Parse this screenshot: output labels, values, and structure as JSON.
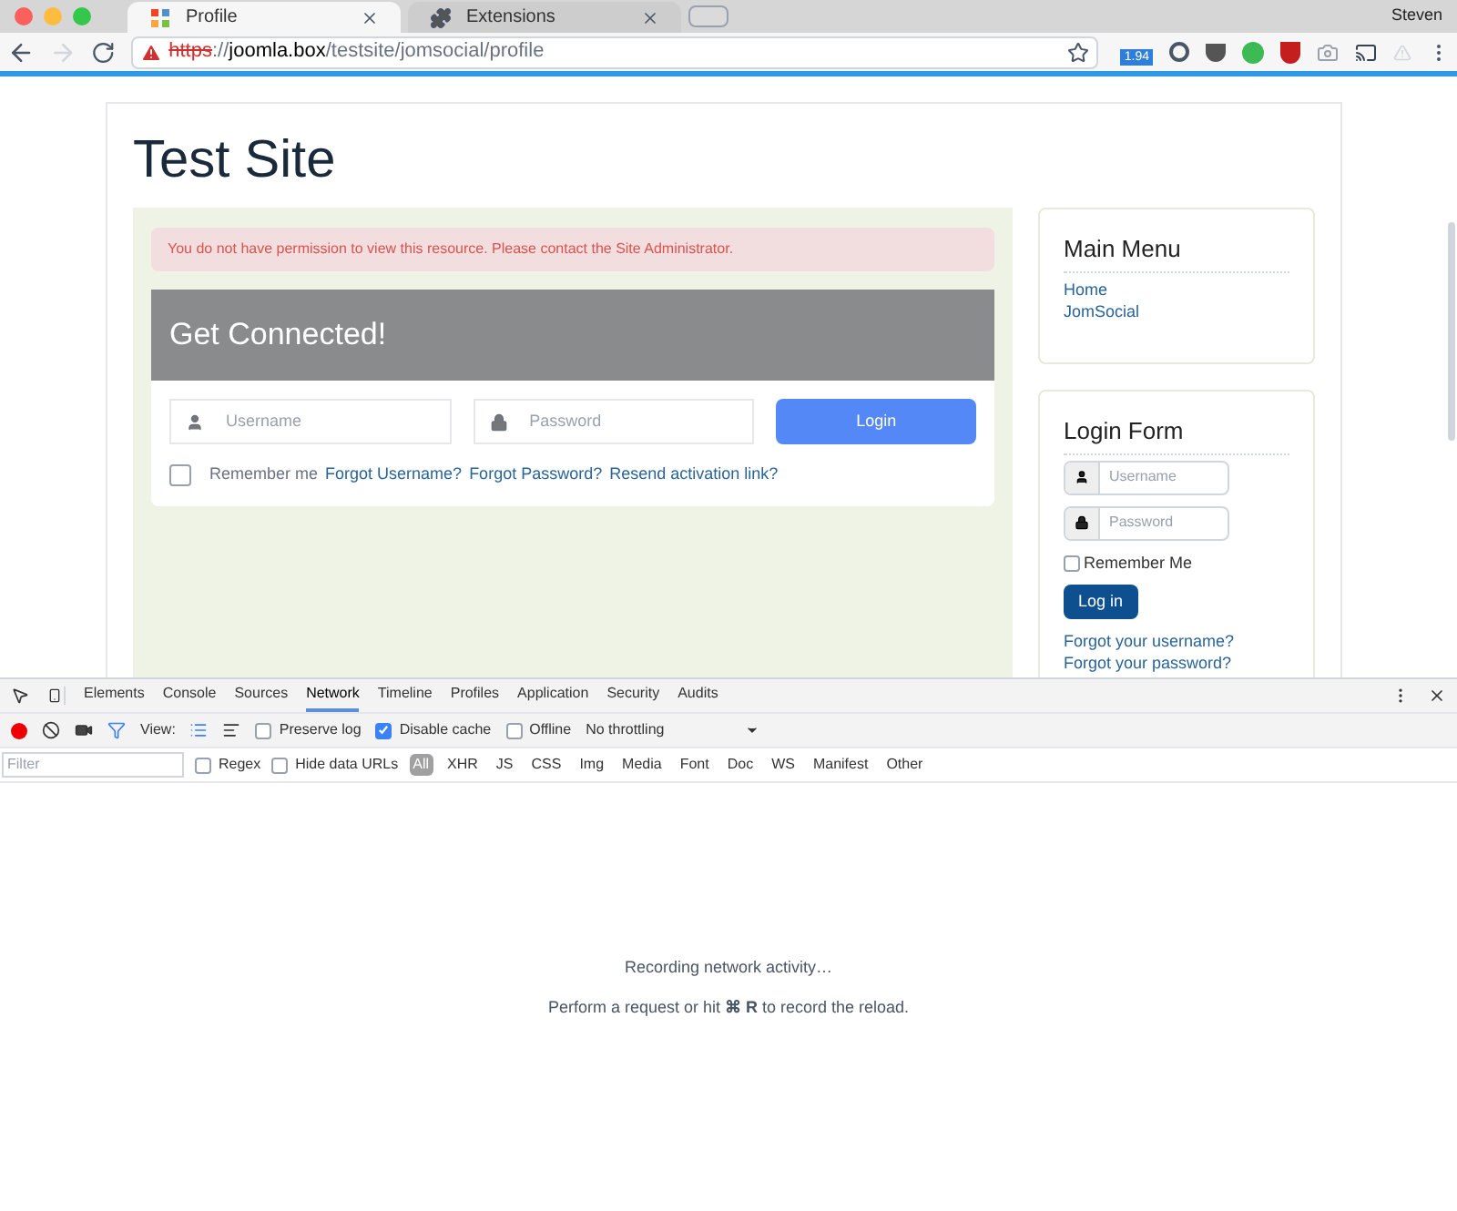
{
  "browser": {
    "tabs": [
      {
        "title": "Profile",
        "selected": true,
        "kind": "joomla"
      },
      {
        "title": "Extensions",
        "selected": false,
        "kind": "puzzle"
      }
    ],
    "user": "Steven",
    "url": {
      "scheme": "https",
      "separator": "://",
      "host": "joomla.box",
      "path": "/testsite/jomsocial/profile"
    },
    "extension_badge": "1.94"
  },
  "page": {
    "site_title": "Test Site",
    "alert": "You do not have permission to view this resource. Please contact the Site Administrator.",
    "card": {
      "heading": "Get Connected!",
      "username_placeholder": "Username",
      "password_placeholder": "Password",
      "login_button": "Login",
      "remember_label": "Remember me",
      "remember_checked": false,
      "links": [
        "Forgot Username?",
        "Forgot Password?",
        "Resend activation link?"
      ]
    },
    "main_menu": {
      "title": "Main Menu",
      "items": [
        "Home",
        "JomSocial"
      ]
    },
    "login_form": {
      "title": "Login Form",
      "username_placeholder": "Username",
      "password_placeholder": "Password",
      "remember_label": "Remember Me",
      "remember_checked": false,
      "button": "Log in",
      "links": [
        "Forgot your username?",
        "Forgot your password?"
      ]
    }
  },
  "devtools": {
    "tabs": [
      {
        "label": "Elements",
        "selected": false
      },
      {
        "label": "Console",
        "selected": false
      },
      {
        "label": "Sources",
        "selected": false
      },
      {
        "label": "Network",
        "selected": true
      },
      {
        "label": "Timeline",
        "selected": false
      },
      {
        "label": "Profiles",
        "selected": false
      },
      {
        "label": "Application",
        "selected": false
      },
      {
        "label": "Security",
        "selected": false
      },
      {
        "label": "Audits",
        "selected": false
      }
    ],
    "recording": true,
    "view_label": "View:",
    "options": [
      {
        "label": "Preserve log",
        "checked": false
      },
      {
        "label": "Disable cache",
        "checked": true
      },
      {
        "label": "Offline",
        "checked": false
      }
    ],
    "throttling": "No throttling",
    "filter_placeholder": "Filter",
    "filter_options": [
      {
        "label": "Regex",
        "checked": false
      },
      {
        "label": "Hide data URLs",
        "checked": false
      }
    ],
    "types": [
      {
        "label": "All",
        "selected": true
      },
      {
        "label": "XHR",
        "selected": false
      },
      {
        "label": "JS",
        "selected": false
      },
      {
        "label": "CSS",
        "selected": false
      },
      {
        "label": "Img",
        "selected": false
      },
      {
        "label": "Media",
        "selected": false
      },
      {
        "label": "Font",
        "selected": false
      },
      {
        "label": "Doc",
        "selected": false
      },
      {
        "label": "WS",
        "selected": false
      },
      {
        "label": "Manifest",
        "selected": false
      },
      {
        "label": "Other",
        "selected": false
      }
    ],
    "messages": [
      "Recording network activity…",
      "Perform a request or hit **⌘ R** to record the reload."
    ]
  }
}
